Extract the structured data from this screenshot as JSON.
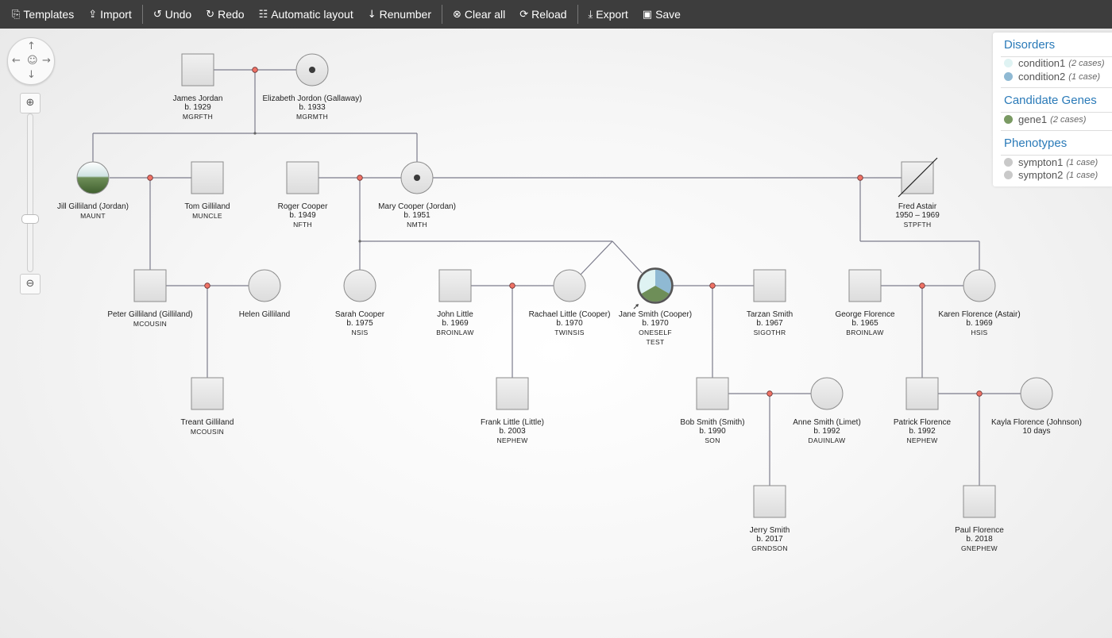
{
  "toolbar": {
    "templates": "Templates",
    "import": "Import",
    "undo": "Undo",
    "redo": "Redo",
    "automatic_layout": "Automatic layout",
    "renumber": "Renumber",
    "clear_all": "Clear all",
    "reload": "Reload",
    "export": "Export",
    "save": "Save"
  },
  "legend": {
    "disorders_title": "Disorders",
    "disorders": [
      {
        "name": "condition1",
        "count": "(2 cases)",
        "color": "#dff3f3"
      },
      {
        "name": "condition2",
        "count": "(1 case)",
        "color": "#8fb9d3"
      }
    ],
    "genes_title": "Candidate Genes",
    "genes": [
      {
        "name": "gene1",
        "count": "(2 cases)",
        "color": "#7a9a63"
      }
    ],
    "phenotypes_title": "Phenotypes",
    "phenotypes": [
      {
        "name": "sympton1",
        "count": "(1 case)",
        "color": "#c9c9c9"
      },
      {
        "name": "sympton2",
        "count": "(1 case)",
        "color": "#c9c9c9"
      }
    ]
  },
  "people": [
    {
      "id": "james",
      "sex": "M",
      "name": "James Jordan",
      "birth": "b. 1929",
      "rel": "MGRFTH"
    },
    {
      "id": "elizabeth",
      "sex": "F",
      "name": "Elizabeth Jordon (Gallaway)",
      "birth": "b. 1933",
      "rel": "MGRMTH",
      "carrier": true
    },
    {
      "id": "jill",
      "sex": "F",
      "name": "Jill Gilliland (Jordan)",
      "birth": "",
      "rel": "MAUNT",
      "affected": "half"
    },
    {
      "id": "tom",
      "sex": "M",
      "name": "Tom Gilliland",
      "birth": "",
      "rel": "MUNCLE"
    },
    {
      "id": "roger",
      "sex": "M",
      "name": "Roger Cooper",
      "birth": "b. 1949",
      "rel": "NFTH"
    },
    {
      "id": "mary",
      "sex": "F",
      "name": "Mary Cooper (Jordan)",
      "birth": "b. 1951",
      "rel": "NMTH",
      "carrier": true
    },
    {
      "id": "fred",
      "sex": "M",
      "name": "Fred Astair",
      "birth": "1950 – 1969",
      "rel": "STPFTH",
      "deceased": true
    },
    {
      "id": "peter",
      "sex": "M",
      "name": "Peter Gilliland (Gilliland)",
      "birth": "",
      "rel": "MCOUSIN"
    },
    {
      "id": "helen",
      "sex": "F",
      "name": "Helen Gilliland",
      "birth": "",
      "rel": ""
    },
    {
      "id": "sarah",
      "sex": "F",
      "name": "Sarah Cooper",
      "birth": "b. 1975",
      "rel": "NSIS"
    },
    {
      "id": "john",
      "sex": "M",
      "name": "John Little",
      "birth": "b. 1969",
      "rel": "BROINLAW"
    },
    {
      "id": "rachael",
      "sex": "F",
      "name": "Rachael Little (Cooper)",
      "birth": "b. 1970",
      "rel": "TWINSIS"
    },
    {
      "id": "jane",
      "sex": "F",
      "name": "Jane Smith (Cooper)",
      "birth": "b. 1970",
      "rel": "ONESELF",
      "extra": "TEST",
      "affected": "pie",
      "proband": true
    },
    {
      "id": "tarzan",
      "sex": "M",
      "name": "Tarzan Smith",
      "birth": "b. 1967",
      "rel": "SIGOTHR"
    },
    {
      "id": "george",
      "sex": "M",
      "name": "George Florence",
      "birth": "b. 1965",
      "rel": "BROINLAW"
    },
    {
      "id": "karen",
      "sex": "F",
      "name": "Karen Florence (Astair)",
      "birth": "b. 1969",
      "rel": "HSIS"
    },
    {
      "id": "treant",
      "sex": "M",
      "name": "Treant Gilliland",
      "birth": "",
      "rel": "MCOUSIN"
    },
    {
      "id": "frank",
      "sex": "M",
      "name": "Frank Little (Little)",
      "birth": "b. 2003",
      "rel": "NEPHEW"
    },
    {
      "id": "bob",
      "sex": "M",
      "name": "Bob Smith (Smith)",
      "birth": "b. 1990",
      "rel": "SON"
    },
    {
      "id": "anne",
      "sex": "F",
      "name": "Anne Smith (Limet)",
      "birth": "b. 1992",
      "rel": "DAUINLAW"
    },
    {
      "id": "patrick",
      "sex": "M",
      "name": "Patrick Florence",
      "birth": "b. 1992",
      "rel": "NEPHEW"
    },
    {
      "id": "kayla",
      "sex": "F",
      "name": "Kayla Florence (Johnson)",
      "birth": "10 days",
      "rel": ""
    },
    {
      "id": "jerry",
      "sex": "M",
      "name": "Jerry Smith",
      "birth": "b. 2017",
      "rel": "GRNDSON"
    },
    {
      "id": "paul",
      "sex": "M",
      "name": "Paul Florence",
      "birth": "b. 2018",
      "rel": "GNEPHEW"
    }
  ],
  "icons": {
    "templates": "copy-icon",
    "import": "upload-icon",
    "undo": "undo-icon",
    "redo": "redo-icon",
    "automatic_layout": "sitemap-icon",
    "renumber": "sort-numeric-icon",
    "clear_all": "times-circle-icon",
    "reload": "refresh-icon",
    "export": "download-icon",
    "save": "floppy-icon"
  }
}
